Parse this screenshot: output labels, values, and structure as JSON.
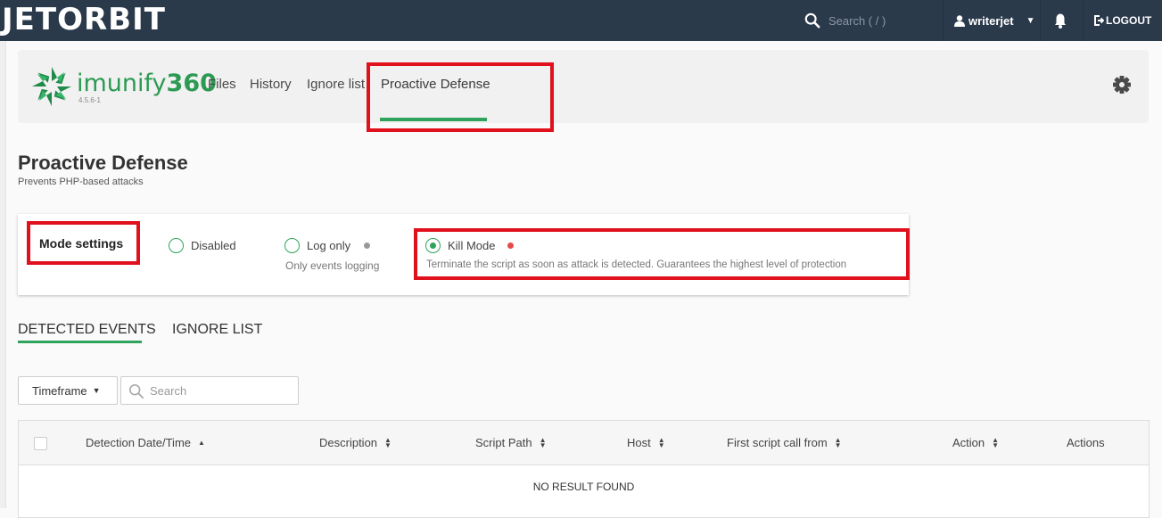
{
  "topbar": {
    "brand": "JETORBIT",
    "search_placeholder": "Search ( / )",
    "user": "writerjet",
    "logout": "LOGOUT"
  },
  "plugin": {
    "name_text": "imunify",
    "name_number": "360",
    "version": "4.5.6-1",
    "nav": [
      "Files",
      "History",
      "Ignore list",
      "Proactive Defense"
    ],
    "active_nav": "Proactive Defense"
  },
  "page": {
    "title": "Proactive Defense",
    "subtitle": "Prevents PHP-based attacks"
  },
  "mode_settings": {
    "title": "Mode settings",
    "options": [
      {
        "label": "Disabled",
        "description": "",
        "selected": false
      },
      {
        "label": "Log only",
        "description": "Only events logging",
        "selected": false,
        "dot_color": "#999999"
      },
      {
        "label": "Kill Mode",
        "description": "Terminate the script as soon as attack is detected. Guarantees the highest level of protection",
        "selected": true,
        "dot_color": "#e64a4a"
      }
    ]
  },
  "tabs": [
    "DETECTED EVENTS",
    "IGNORE LIST"
  ],
  "active_tab": "DETECTED EVENTS",
  "filters": {
    "timeframe_label": "Timeframe",
    "search_placeholder": "Search"
  },
  "table": {
    "columns": [
      "Detection Date/Time",
      "Description",
      "Script Path",
      "Host",
      "First script call from",
      "Action",
      "Actions"
    ],
    "empty_message": "NO RESULT FOUND"
  },
  "colors": {
    "topbar": "#2b3a4b",
    "accent_green": "#2fa35b",
    "annotation_red": "#e0111d"
  }
}
